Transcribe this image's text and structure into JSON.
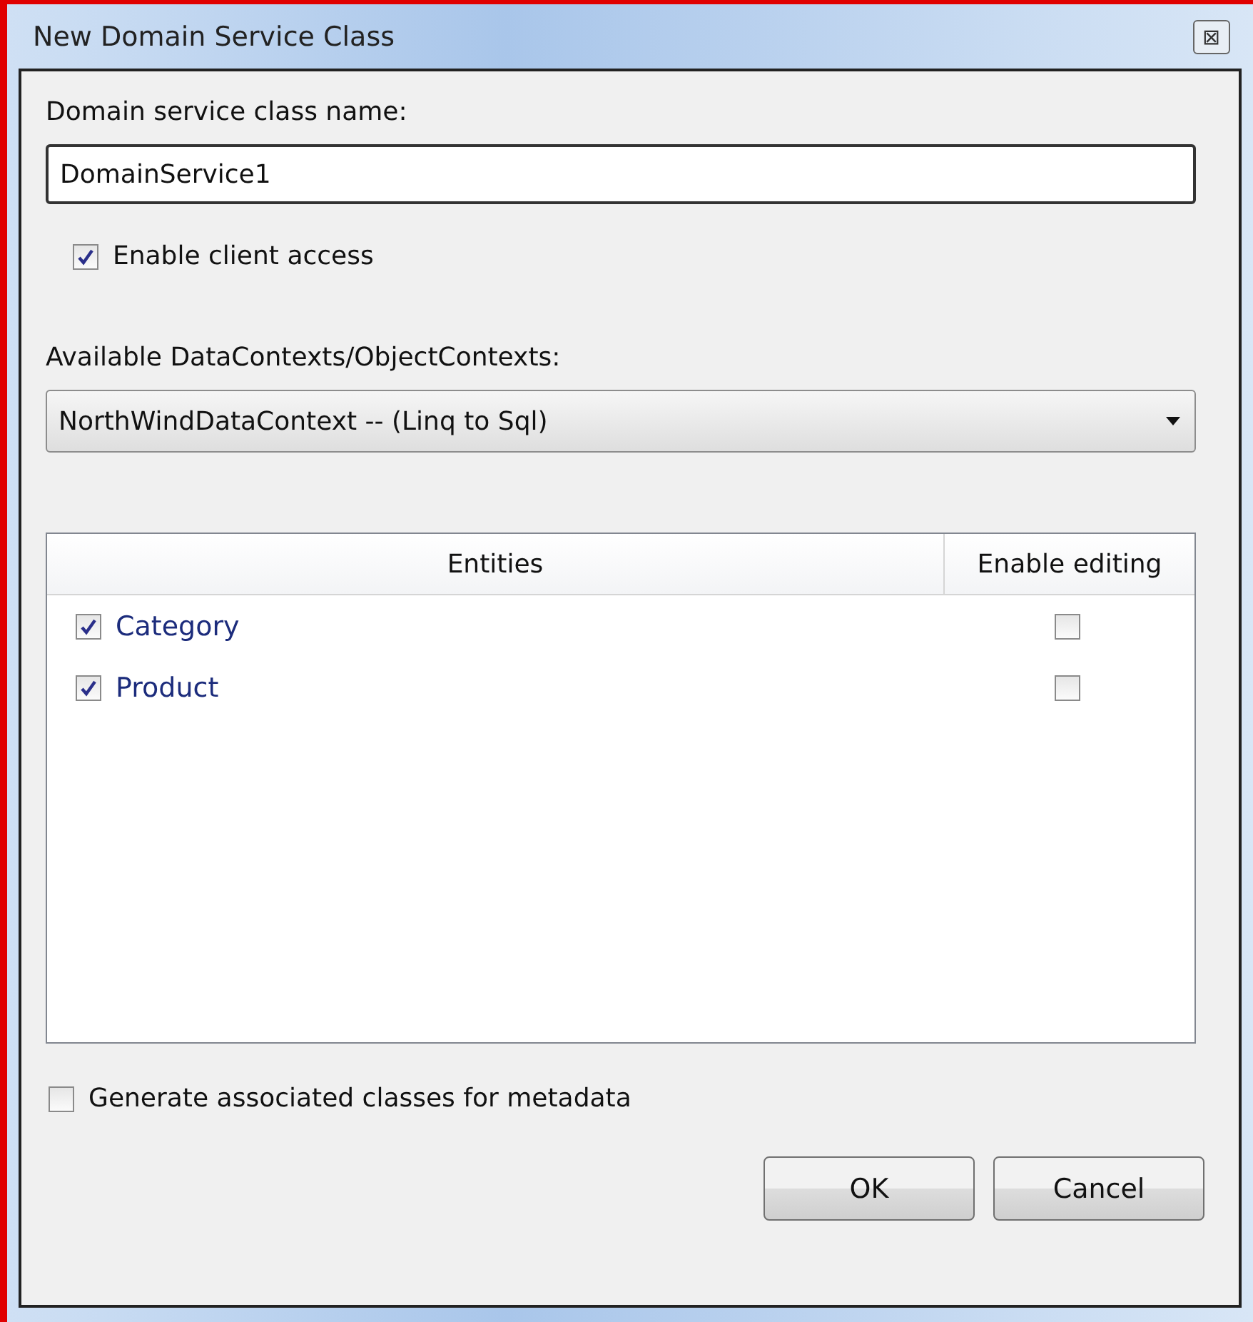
{
  "window": {
    "title": "New Domain Service Class",
    "close": "⊠"
  },
  "name_label": "Domain service class name:",
  "name_value": "DomainService1",
  "client_access": {
    "label": "Enable client access",
    "checked": true
  },
  "contexts_label": "Available DataContexts/ObjectContexts:",
  "contexts_value": "NorthWindDataContext -- (Linq to Sql)",
  "table": {
    "columns": [
      "Entities",
      "Enable editing"
    ],
    "rows": [
      {
        "name": "Category",
        "checked": true,
        "editing": false
      },
      {
        "name": "Product",
        "checked": true,
        "editing": false
      }
    ]
  },
  "metadata": {
    "label": "Generate associated classes for metadata",
    "checked": false
  },
  "buttons": [
    "OK",
    "Cancel"
  ]
}
